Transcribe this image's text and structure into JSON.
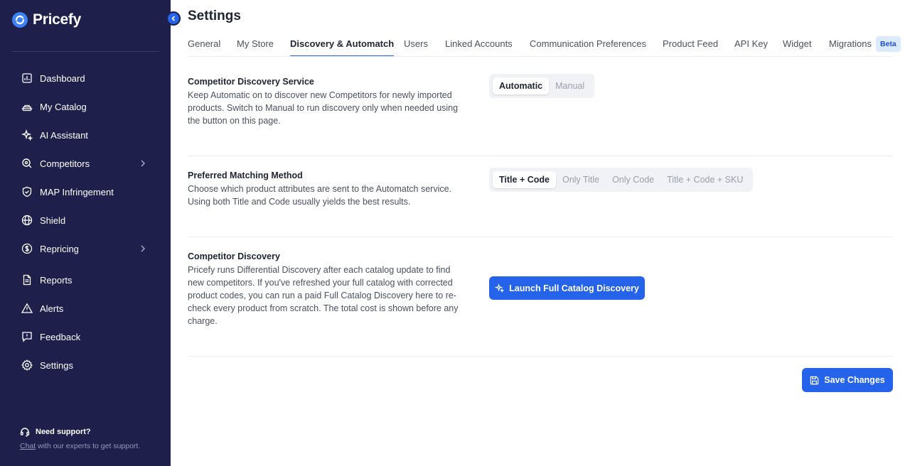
{
  "brand": {
    "name": "Pricefy"
  },
  "sidebar": {
    "items": [
      {
        "label": "Dashboard",
        "icon": "chart-icon"
      },
      {
        "label": "My Catalog",
        "icon": "catalog-icon"
      },
      {
        "label": "AI Assistant",
        "icon": "sparkles-icon"
      },
      {
        "label": "Competitors",
        "icon": "search-icon"
      },
      {
        "label": "MAP Infringement",
        "icon": "shield-check-icon"
      },
      {
        "label": "Shield",
        "icon": "globe-icon"
      },
      {
        "label": "Repricing",
        "icon": "dollar-circle-icon"
      },
      {
        "label": "Reports",
        "icon": "document-icon"
      },
      {
        "label": "Alerts",
        "icon": "warning-icon"
      },
      {
        "label": "Feedback",
        "icon": "feedback-icon"
      },
      {
        "label": "Settings",
        "icon": "gear-icon"
      }
    ],
    "support": {
      "title": "Need support?",
      "chat": "Chat",
      "rest": " with our experts to get support."
    }
  },
  "header": {
    "title": "Settings"
  },
  "tabs": [
    {
      "label": "General"
    },
    {
      "label": "My Store"
    },
    {
      "label": "Discovery & Automatch"
    },
    {
      "label": "Users"
    },
    {
      "label": "Linked Accounts"
    },
    {
      "label": "Communication Preferences"
    },
    {
      "label": "Product Feed"
    },
    {
      "label": "API Key"
    },
    {
      "label": "Widget"
    },
    {
      "label": "Migrations",
      "badge": "Beta"
    }
  ],
  "sections": {
    "discovery_service": {
      "title": "Competitor Discovery Service",
      "desc": "Keep Automatic on to discover new Competitors for newly imported products. Switch to Manual to run discovery only when needed using the button on this page.",
      "options": [
        "Automatic",
        "Manual"
      ],
      "selected": "Automatic"
    },
    "matching_method": {
      "title": "Preferred Matching Method",
      "desc": "Choose which product attributes are sent to the Automatch service. Using both Title and Code usually yields the best results.",
      "options": [
        "Title + Code",
        "Only Title",
        "Only Code",
        "Title + Code + SKU"
      ],
      "selected": "Title + Code"
    },
    "competitor_discovery": {
      "title": "Competitor Discovery",
      "desc": "Pricefy runs Differential Discovery after each catalog update to find new competitors. If you've refreshed your full catalog with corrected product codes, you can run a paid Full Catalog Discovery here to re-check every product from scratch. The total cost is shown before any charge.",
      "button": "Launch Full Catalog Discovery"
    }
  },
  "footer": {
    "save_label": "Save Changes"
  },
  "colors": {
    "sidebar_bg": "#1e1f4b",
    "accent": "#2563eb",
    "beta_bg": "#dbeafe"
  }
}
